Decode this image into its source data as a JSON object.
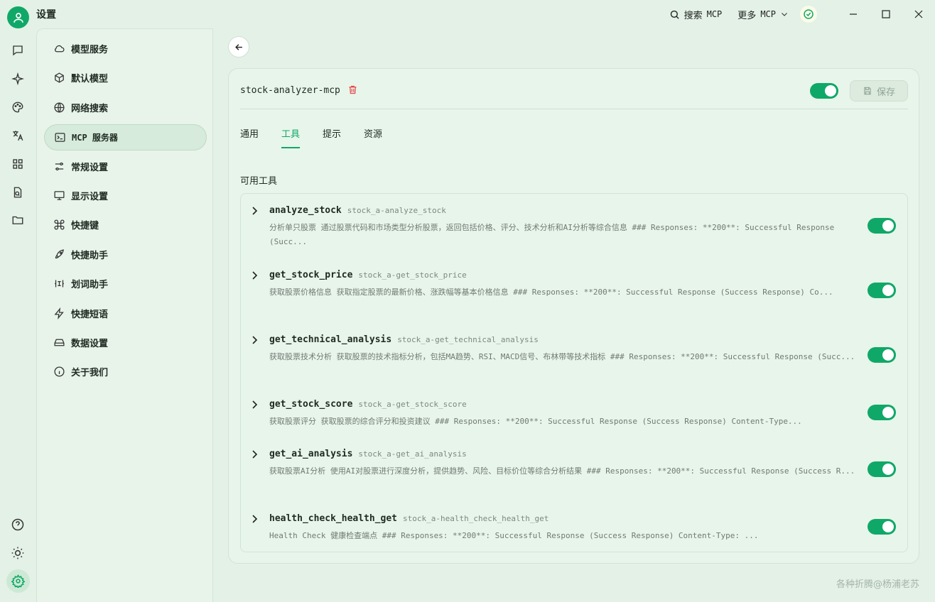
{
  "titlebar": {
    "title": "设置",
    "search_label": "搜索",
    "search_mono": "MCP",
    "more_label": "更多",
    "more_mono": "MCP"
  },
  "nav": {
    "items": [
      {
        "label": "模型服务",
        "icon": "cloud-icon"
      },
      {
        "label": "默认模型",
        "icon": "cube-icon"
      },
      {
        "label": "网络搜索",
        "icon": "globe-icon"
      },
      {
        "label": "MCP 服务器",
        "icon": "terminal-icon"
      },
      {
        "label": "常规设置",
        "icon": "sliders-icon"
      },
      {
        "label": "显示设置",
        "icon": "monitor-icon"
      },
      {
        "label": "快捷键",
        "icon": "command-icon"
      },
      {
        "label": "快捷助手",
        "icon": "rocket-icon"
      },
      {
        "label": "划词助手",
        "icon": "text-select-icon"
      },
      {
        "label": "快捷短语",
        "icon": "zap-icon"
      },
      {
        "label": "数据设置",
        "icon": "hard-drive-icon"
      },
      {
        "label": "关于我们",
        "icon": "info-icon"
      }
    ]
  },
  "server": {
    "name": "stock-analyzer-mcp",
    "save_label": "保存",
    "enabled": true
  },
  "tabs": [
    "通用",
    "工具",
    "提示",
    "资源"
  ],
  "section_title": "可用工具",
  "tools": [
    {
      "name": "analyze_stock",
      "id": "stock_a-analyze_stock",
      "desc": "分析单只股票 通过股票代码和市场类型分析股票，返回包括价格、评分、技术分析和AI分析等综合信息 ### Responses: **200**: Successful Response (Succ..."
    },
    {
      "name": "get_stock_price",
      "id": "stock_a-get_stock_price",
      "desc": "获取股票价格信息 获取指定股票的最新价格、涨跌幅等基本价格信息 ### Responses: **200**: Successful Response (Success Response) Co..."
    },
    {
      "name": "get_technical_analysis",
      "id": "stock_a-get_technical_analysis",
      "desc": "获取股票技术分析 获取股票的技术指标分析，包括MA趋势、RSI、MACD信号、布林带等技术指标 ### Responses: **200**: Successful Response (Succ..."
    },
    {
      "name": "get_stock_score",
      "id": "stock_a-get_stock_score",
      "desc": "获取股票评分 获取股票的综合评分和投资建议 ### Responses: **200**: Successful Response (Success Response) Content-Type..."
    },
    {
      "name": "get_ai_analysis",
      "id": "stock_a-get_ai_analysis",
      "desc": "获取股票AI分析 使用AI对股票进行深度分析，提供趋势、风险、目标价位等综合分析结果 ### Responses: **200**: Successful Response (Success R..."
    },
    {
      "name": "health_check_health_get",
      "id": "stock_a-health_check_health_get",
      "desc": "Health Check 健康检查端点 ### Responses: **200**: Successful Response (Success Response) Content-Type: ..."
    }
  ],
  "watermark": "各种折腾@杨浦老苏",
  "colors": {
    "accent": "#10a868",
    "background": "#e3f1e6"
  }
}
